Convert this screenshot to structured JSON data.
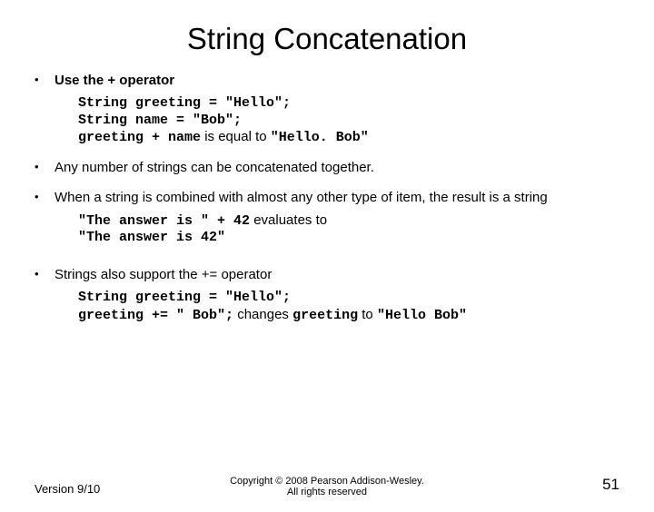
{
  "title": "String Concatenation",
  "bullets": {
    "b1": "Use the + operator",
    "b2": "Any number of strings can be concatenated together.",
    "b3": "When a string is combined with almost any other type of item, the result is a string",
    "b4": "Strings also support the += operator"
  },
  "code": {
    "line1": "String greeting = \"Hello\";",
    "line2": "String name =  \"Bob\";",
    "line3_code": "greeting + name",
    "line3_text": " is equal to ",
    "line3_result": "\"Hello. Bob\"",
    "ex2_line1_code": "\"The answer is \" + 42",
    "ex2_line1_text": " evaluates to",
    "ex2_line2_code": "\"The answer is 42\"",
    "ex3_line1": "String greeting = \"Hello\";",
    "ex3_line2_code": "greeting += \" Bob\";",
    "ex3_line2_text": " changes ",
    "ex3_line2_code2": "greeting",
    "ex3_line2_text2": " to ",
    "ex3_line2_result": "\"Hello Bob\""
  },
  "footer": {
    "version": "Version 9/10",
    "copyright_line1": "Copyright © 2008 Pearson Addison-Wesley.",
    "copyright_line2": "All rights reserved",
    "pagenum": "51"
  }
}
